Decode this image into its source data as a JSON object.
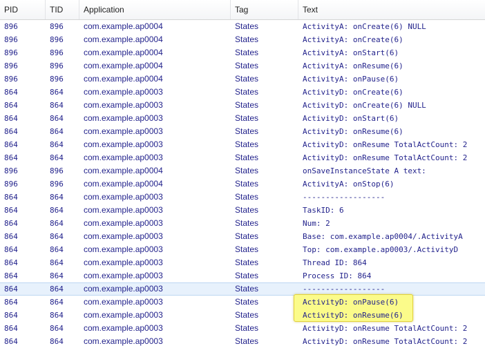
{
  "header": {
    "pid": "PID",
    "tid": "TID",
    "application": "Application",
    "tag": "Tag",
    "text": "Text"
  },
  "rows": [
    {
      "pid": "896",
      "tid": "896",
      "app": "com.example.ap0004",
      "tag": "States",
      "text": "ActivityA: onCreate(6) NULL"
    },
    {
      "pid": "896",
      "tid": "896",
      "app": "com.example.ap0004",
      "tag": "States",
      "text": "ActivityA: onCreate(6)"
    },
    {
      "pid": "896",
      "tid": "896",
      "app": "com.example.ap0004",
      "tag": "States",
      "text": "ActivityA: onStart(6)"
    },
    {
      "pid": "896",
      "tid": "896",
      "app": "com.example.ap0004",
      "tag": "States",
      "text": "ActivityA: onResume(6)"
    },
    {
      "pid": "896",
      "tid": "896",
      "app": "com.example.ap0004",
      "tag": "States",
      "text": "ActivityA: onPause(6)"
    },
    {
      "pid": "864",
      "tid": "864",
      "app": "com.example.ap0003",
      "tag": "States",
      "text": "ActivityD: onCreate(6)"
    },
    {
      "pid": "864",
      "tid": "864",
      "app": "com.example.ap0003",
      "tag": "States",
      "text": "ActivityD: onCreate(6) NULL"
    },
    {
      "pid": "864",
      "tid": "864",
      "app": "com.example.ap0003",
      "tag": "States",
      "text": "ActivityD: onStart(6)"
    },
    {
      "pid": "864",
      "tid": "864",
      "app": "com.example.ap0003",
      "tag": "States",
      "text": "ActivityD: onResume(6)"
    },
    {
      "pid": "864",
      "tid": "864",
      "app": "com.example.ap0003",
      "tag": "States",
      "text": "ActivityD: onResume TotalActCount: 2"
    },
    {
      "pid": "864",
      "tid": "864",
      "app": "com.example.ap0003",
      "tag": "States",
      "text": "ActivityD: onResume TotalActCount: 2"
    },
    {
      "pid": "896",
      "tid": "896",
      "app": "com.example.ap0004",
      "tag": "States",
      "text": "onSaveInstanceState A text:"
    },
    {
      "pid": "896",
      "tid": "896",
      "app": "com.example.ap0004",
      "tag": "States",
      "text": "ActivityA: onStop(6)"
    },
    {
      "pid": "864",
      "tid": "864",
      "app": "com.example.ap0003",
      "tag": "States",
      "text": "------------------"
    },
    {
      "pid": "864",
      "tid": "864",
      "app": "com.example.ap0003",
      "tag": "States",
      "text": "TaskID: 6"
    },
    {
      "pid": "864",
      "tid": "864",
      "app": "com.example.ap0003",
      "tag": "States",
      "text": "Num: 2"
    },
    {
      "pid": "864",
      "tid": "864",
      "app": "com.example.ap0003",
      "tag": "States",
      "text": "Base: com.example.ap0004/.ActivityA"
    },
    {
      "pid": "864",
      "tid": "864",
      "app": "com.example.ap0003",
      "tag": "States",
      "text": "Top: com.example.ap0003/.ActivityD"
    },
    {
      "pid": "864",
      "tid": "864",
      "app": "com.example.ap0003",
      "tag": "States",
      "text": "Thread ID: 864"
    },
    {
      "pid": "864",
      "tid": "864",
      "app": "com.example.ap0003",
      "tag": "States",
      "text": "Process ID: 864"
    },
    {
      "pid": "864",
      "tid": "864",
      "app": "com.example.ap0003",
      "tag": "States",
      "text": "------------------",
      "selected": true
    },
    {
      "pid": "864",
      "tid": "864",
      "app": "com.example.ap0003",
      "tag": "States",
      "text": "ActivityD: onPause(6)",
      "highlighted": true
    },
    {
      "pid": "864",
      "tid": "864",
      "app": "com.example.ap0003",
      "tag": "States",
      "text": "ActivityD: onResume(6)",
      "highlighted": true
    },
    {
      "pid": "864",
      "tid": "864",
      "app": "com.example.ap0003",
      "tag": "States",
      "text": "ActivityD: onResume TotalActCount: 2"
    },
    {
      "pid": "864",
      "tid": "864",
      "app": "com.example.ap0003",
      "tag": "States",
      "text": "ActivityD: onResume TotalActCount: 2"
    }
  ],
  "colors": {
    "row_text": "#1f1f8a",
    "selected_row": "#e7f1fc",
    "highlight": "#fbfb8a"
  }
}
